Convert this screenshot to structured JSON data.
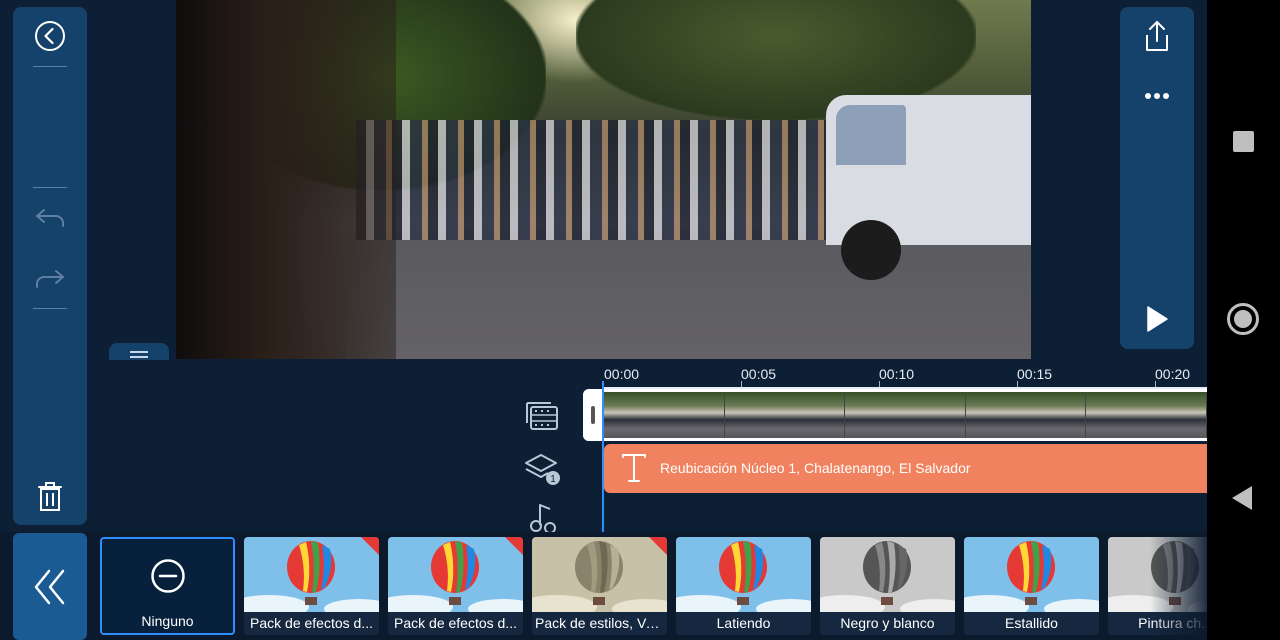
{
  "timeline": {
    "ticks": [
      "00:00",
      "00:05",
      "00:10",
      "00:15",
      "00:20"
    ],
    "text_clip_label": "Reubicación Núcleo 1, Chalatenango, El Salvador",
    "layer_badge": "1"
  },
  "left_toolbar": {
    "icons": [
      "back-circle-icon",
      "undo-icon",
      "redo-icon",
      "trash-icon"
    ]
  },
  "right_toolbar": {
    "icons": [
      "share-icon",
      "more-icon",
      "play-icon"
    ]
  },
  "effects": {
    "items": [
      {
        "label": "Ninguno",
        "selected": true,
        "thumb": "none-icon",
        "new": false
      },
      {
        "label": "Pack de efectos d...",
        "selected": false,
        "thumb": "balloon-color",
        "new": true
      },
      {
        "label": "Pack de efectos d...",
        "selected": false,
        "thumb": "balloon-color",
        "new": true
      },
      {
        "label": "Pack de estilos, Vo...",
        "selected": false,
        "thumb": "balloon-sepia",
        "new": true
      },
      {
        "label": "Latiendo",
        "selected": false,
        "thumb": "balloon-color",
        "new": false
      },
      {
        "label": "Negro y blanco",
        "selected": false,
        "thumb": "balloon-gray",
        "new": false
      },
      {
        "label": "Estallido",
        "selected": false,
        "thumb": "balloon-color",
        "new": false
      },
      {
        "label": "Pintura ch...",
        "selected": false,
        "thumb": "balloon-gray",
        "new": false
      }
    ]
  },
  "colors": {
    "panel": "#14426a",
    "background": "#0d1f35",
    "accent": "#2f8dff",
    "text_clip": "#f0825f"
  }
}
